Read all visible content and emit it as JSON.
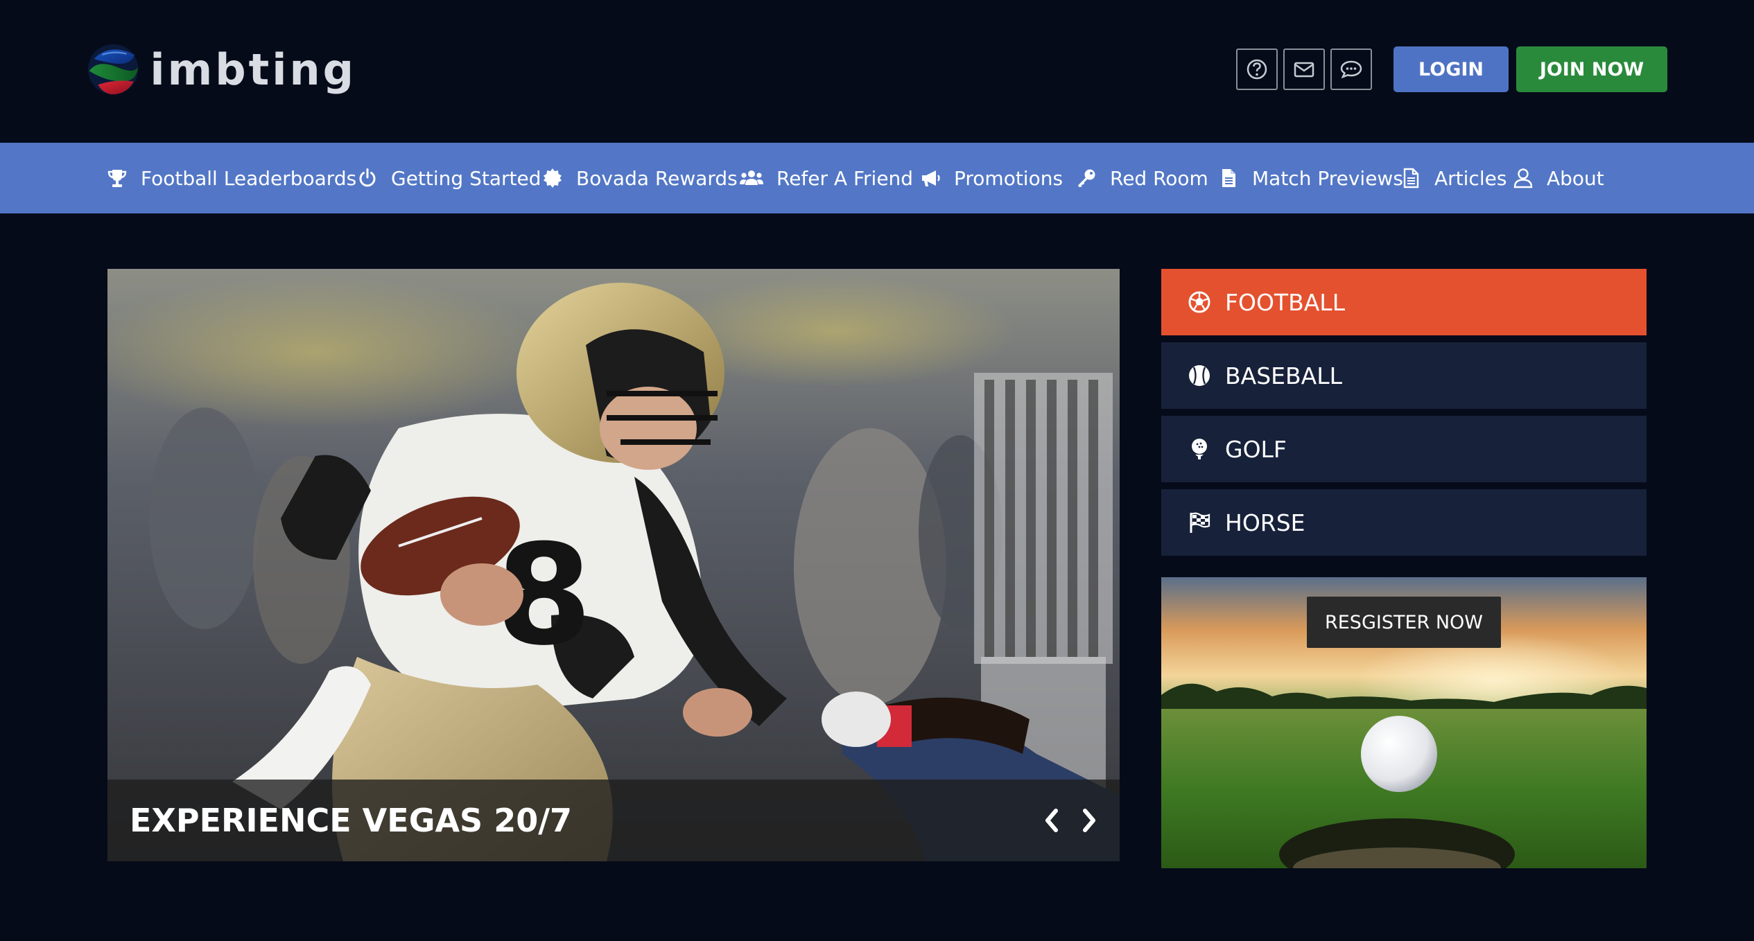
{
  "brand": {
    "name": "imbting"
  },
  "header": {
    "icons": [
      "help-icon",
      "mail-icon",
      "chat-icon"
    ],
    "login_label": "LOGIN",
    "join_label": "JOIN NOW"
  },
  "nav": {
    "items": [
      {
        "label": "Football Leaderboards",
        "icon": "trophy-icon"
      },
      {
        "label": "Getting Started",
        "icon": "power-icon"
      },
      {
        "label": "Bovada Rewards",
        "icon": "badge-icon"
      },
      {
        "label": "Refer A Friend",
        "icon": "users-icon"
      },
      {
        "label": "Promotions",
        "icon": "megaphone-icon"
      },
      {
        "label": "Red Room",
        "icon": "key-icon"
      },
      {
        "label": "Match Previews",
        "icon": "document-icon"
      },
      {
        "label": "Articles",
        "icon": "document-outline-icon"
      },
      {
        "label": "About",
        "icon": "user-icon"
      }
    ]
  },
  "hero": {
    "title": "EXPERIENCE VEGAS 20/7",
    "image": "football-player-photo"
  },
  "sports": [
    {
      "label": "FOOTBALL",
      "icon": "soccer-ball-icon",
      "active": true
    },
    {
      "label": "BASEBALL",
      "icon": "baseball-icon",
      "active": false
    },
    {
      "label": "GOLF",
      "icon": "golf-ball-icon",
      "active": false
    },
    {
      "label": "HORSE",
      "icon": "checkered-flag-icon",
      "active": false
    }
  ],
  "promo": {
    "button_label": "RESGISTER NOW",
    "image": "golf-ball-on-green-photo"
  },
  "colors": {
    "background": "#060b1a",
    "nav": "#5377c6",
    "login": "#4f73c4",
    "join": "#2a8a3c",
    "active_sport": "#e4512f",
    "sport_tile": "#17213a"
  }
}
